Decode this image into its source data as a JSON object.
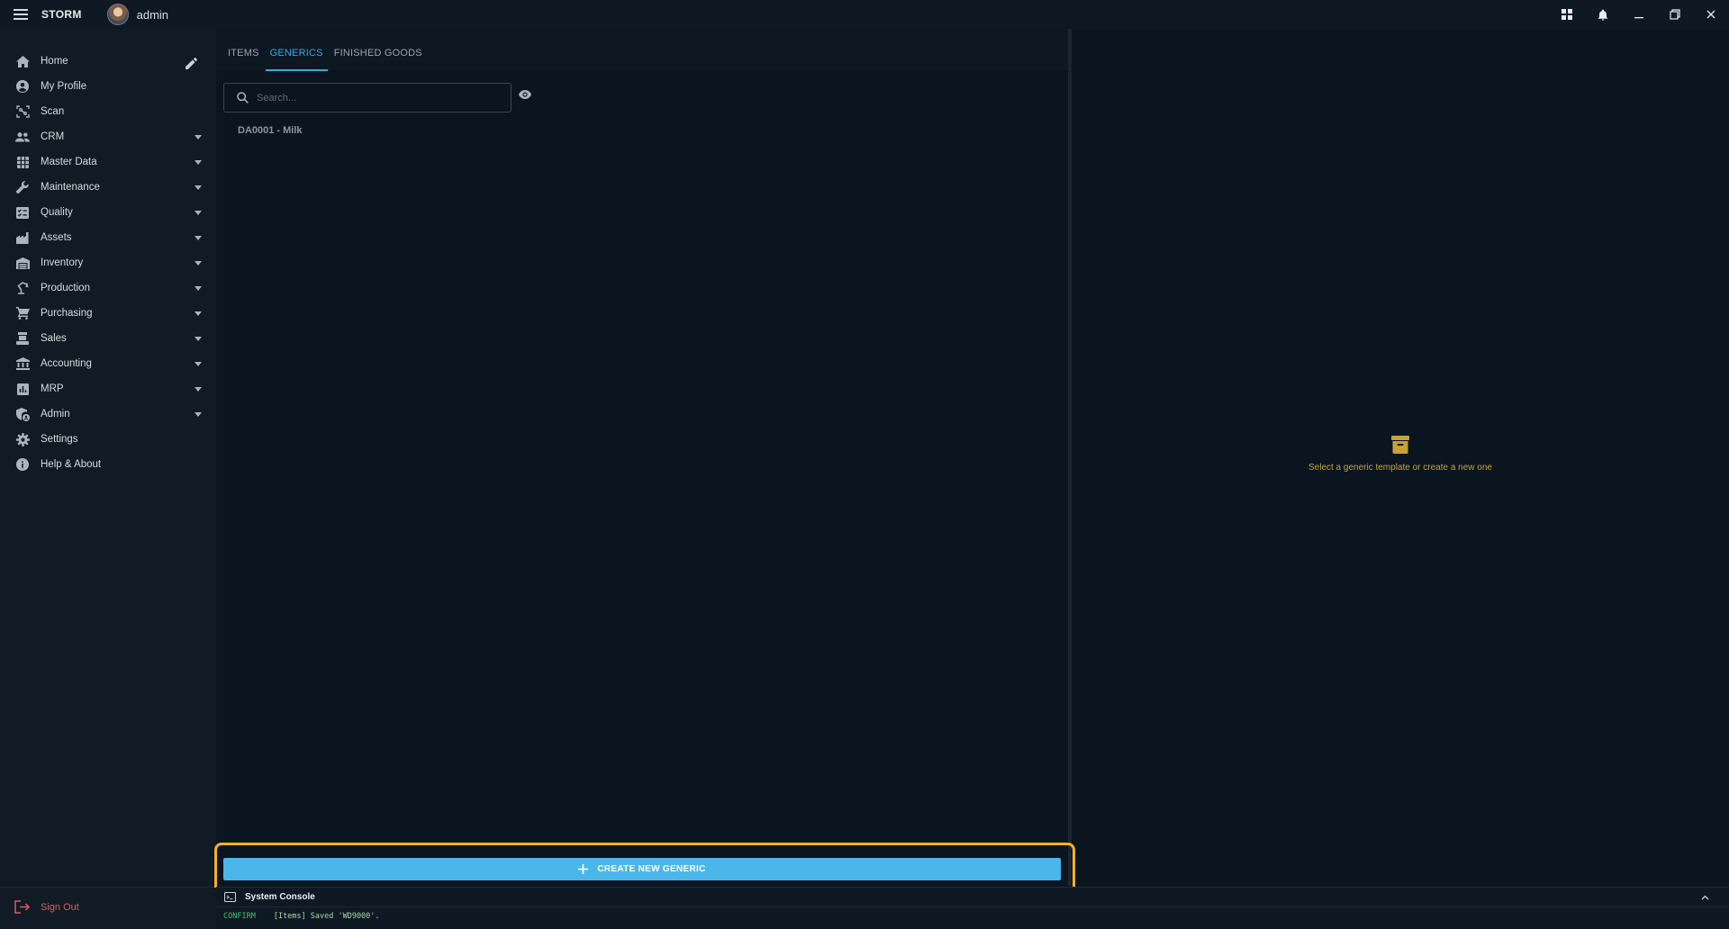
{
  "titlebar": {
    "app_name": "STORM",
    "user_name": "admin"
  },
  "sidebar": {
    "items": [
      {
        "label": "Home",
        "icon": "home-icon",
        "expandable": false
      },
      {
        "label": "My Profile",
        "icon": "account-circle-icon",
        "expandable": false
      },
      {
        "label": "Scan",
        "icon": "scan-icon",
        "expandable": false
      },
      {
        "label": "CRM",
        "icon": "people-icon",
        "expandable": true
      },
      {
        "label": "Master Data",
        "icon": "grid-icon",
        "expandable": true
      },
      {
        "label": "Maintenance",
        "icon": "wrench-icon",
        "expandable": true
      },
      {
        "label": "Quality",
        "icon": "checklist-icon",
        "expandable": true
      },
      {
        "label": "Assets",
        "icon": "factory-icon",
        "expandable": true
      },
      {
        "label": "Inventory",
        "icon": "warehouse-icon",
        "expandable": true
      },
      {
        "label": "Production",
        "icon": "robot-arm-icon",
        "expandable": true
      },
      {
        "label": "Purchasing",
        "icon": "cart-icon",
        "expandable": true
      },
      {
        "label": "Sales",
        "icon": "register-icon",
        "expandable": true
      },
      {
        "label": "Accounting",
        "icon": "bank-icon",
        "expandable": true
      },
      {
        "label": "MRP",
        "icon": "bar-chart-icon",
        "expandable": true
      },
      {
        "label": "Admin",
        "icon": "admin-shield-icon",
        "expandable": true
      },
      {
        "label": "Settings",
        "icon": "gear-icon",
        "expandable": false
      },
      {
        "label": "Help & About",
        "icon": "info-icon",
        "expandable": false
      }
    ],
    "sign_out": "Sign Out"
  },
  "tabs": [
    {
      "label": "ITEMS",
      "active": false
    },
    {
      "label": "GENERICS",
      "active": true
    },
    {
      "label": "FINISHED GOODS",
      "active": false
    }
  ],
  "search": {
    "placeholder": "Search...",
    "value": ""
  },
  "list": {
    "items": [
      "DA0001 - Milk"
    ]
  },
  "detail": {
    "empty_message": "Select a generic template or create a new one"
  },
  "create_button": {
    "label": "CREATE NEW GENERIC"
  },
  "console": {
    "title": "System Console",
    "level": "CONFIRM",
    "message": "[Items] Saved 'WD9000'."
  },
  "colors": {
    "accent": "#3ba8e0",
    "button": "#4bb6ea",
    "highlight": "#f5b21c",
    "empty_state": "#c6a23a",
    "sign_out": "#e05a5a",
    "console_ok": "#3cc46a"
  }
}
